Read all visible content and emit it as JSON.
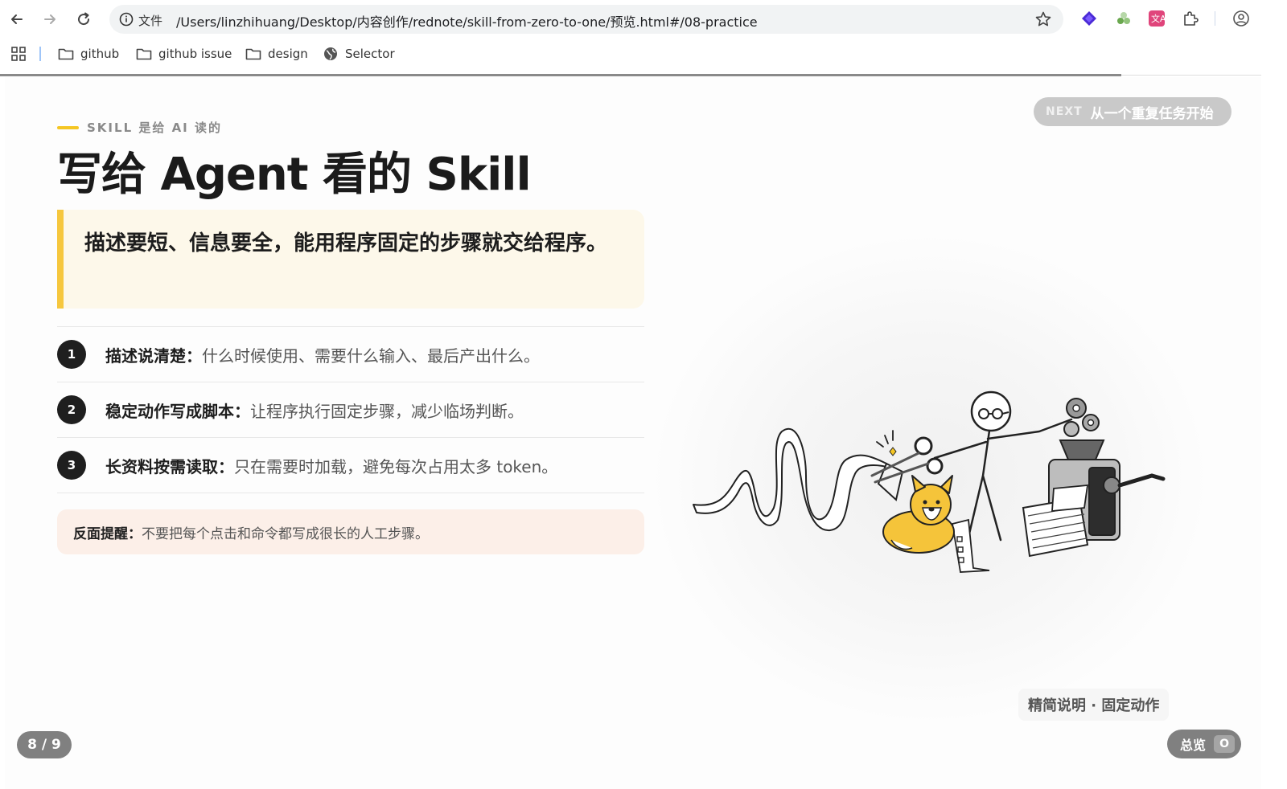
{
  "browser": {
    "scheme_label": "文件",
    "url": "/Users/linzhihuang/Desktop/内容创作/rednote/skill-from-zero-to-one/预览.html#/08-practice",
    "bookmarks": [
      {
        "label": "github",
        "icon": "folder-icon"
      },
      {
        "label": "github issue",
        "icon": "folder-icon"
      },
      {
        "label": "design",
        "icon": "folder-icon"
      },
      {
        "label": "Selector",
        "icon": "globe-icon"
      }
    ],
    "extensions": [
      "purple-diamond-extension-icon",
      "green-extension-icon",
      "translate-extension-icon",
      "puzzle-extensions-icon",
      "profile-icon"
    ],
    "slide_progress": 0.889
  },
  "slide": {
    "eyebrow": "SKILL 是给 AI 读的",
    "title": "写给 Agent 看的 Skill",
    "callout": "描述要短、信息要全，能用程序固定的步骤就交给程序。",
    "items": [
      {
        "num": "1",
        "label": "描述说清楚：",
        "desc": "什么时候使用、需要什么输入、最后产出什么。"
      },
      {
        "num": "2",
        "label": "稳定动作写成脚本：",
        "desc": "让程序执行固定步骤，减少临场判断。"
      },
      {
        "num": "3",
        "label": "长资料按需读取：",
        "desc": "只在需要时加载，避免每次占用太多 token。"
      }
    ],
    "warning": {
      "label": "反面提醒：",
      "text": "不要把每个点击和命令都写成很长的人工步骤。"
    },
    "next": {
      "tag": "NEXT",
      "title": "从一个重复任务开始"
    },
    "caption": "精简说明 · 固定动作",
    "page_indicator": "8 / 9",
    "overview": {
      "label": "总览",
      "key": "O"
    },
    "accent_color": "#f6c73e"
  }
}
